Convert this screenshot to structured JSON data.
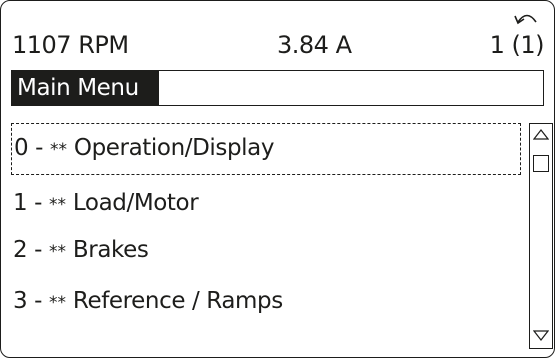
{
  "status": {
    "speed": "1107 RPM",
    "current": "3.84 A",
    "setup": "1 (1)",
    "setup_icon": "cycle-arrow-icon"
  },
  "title": "Main Menu",
  "menu": {
    "items": [
      {
        "number": "0 -",
        "stars": "**",
        "label": "Operation/Display",
        "selected": true
      },
      {
        "number": "1 -",
        "stars": "**",
        "label": "Load/Motor",
        "selected": false
      },
      {
        "number": "2 -",
        "stars": "**",
        "label": "Brakes",
        "selected": false
      },
      {
        "number": "3 -",
        "stars": "**",
        "label": "Reference / Ramps",
        "selected": false
      }
    ]
  },
  "scrollbar": {
    "up_icon": "triangle-up-icon",
    "down_icon": "triangle-down-icon",
    "position": 0
  },
  "colors": {
    "foreground": "#1d1d1b",
    "background": "#ffffff"
  }
}
